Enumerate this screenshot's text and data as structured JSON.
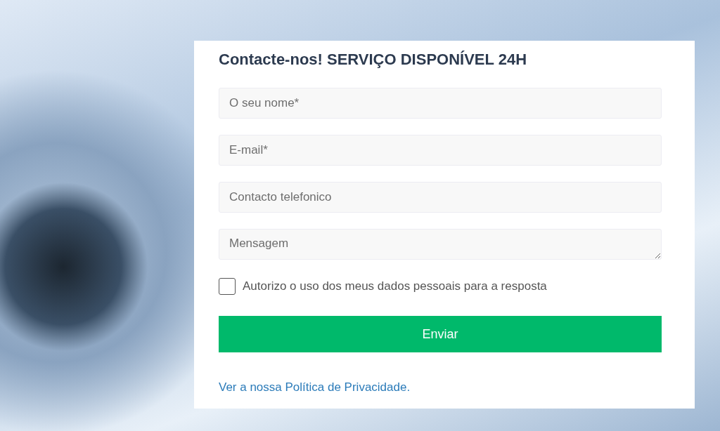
{
  "form": {
    "title": "Contacte-nos! SERVIÇO DISPONÍVEL 24H",
    "fields": [
      {
        "kind": "input",
        "placeholder": "O seu nome*"
      },
      {
        "kind": "input",
        "placeholder": "E-mail*"
      },
      {
        "kind": "input",
        "placeholder": "Contacto telefonico"
      },
      {
        "kind": "textarea",
        "placeholder": "Mensagem"
      }
    ],
    "consent": {
      "label": "Autorizo o uso dos meus dados pessoais para a resposta",
      "checked": false
    },
    "submit_button": "Enviar",
    "privacy_link": "Ver a nossa Política de Privacidade."
  }
}
